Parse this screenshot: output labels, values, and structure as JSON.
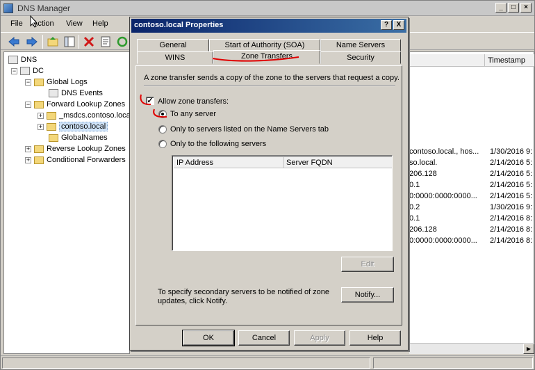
{
  "main": {
    "title": "DNS Manager",
    "menu": [
      "File",
      "Action",
      "View",
      "Help"
    ]
  },
  "tree": {
    "root": "DNS",
    "server": "DC",
    "global_logs": "Global Logs",
    "dns_events": "DNS Events",
    "forward_zones": "Forward Lookup Zones",
    "msdcs": "_msdcs.contoso.local",
    "contoso": "contoso.local",
    "globalnames": "GlobalNames",
    "reverse_zones": "Reverse Lookup Zones",
    "conditional": "Conditional Forwarders"
  },
  "list": {
    "timestamp_header": "Timestamp",
    "rows": [
      {
        "data": "contoso.local., hos...",
        "ts": "1/30/2016 9:"
      },
      {
        "data": "so.local.",
        "ts": "2/14/2016 5:"
      },
      {
        "data": "206.128",
        "ts": "2/14/2016 5:"
      },
      {
        "data": "0.1",
        "ts": "2/14/2016 5:"
      },
      {
        "data": "0:0000:0000:0000...",
        "ts": "2/14/2016 5:"
      },
      {
        "data": "0.2",
        "ts": "1/30/2016 9:"
      },
      {
        "data": "0.1",
        "ts": "2/14/2016 8:"
      },
      {
        "data": "206.128",
        "ts": "2/14/2016 8:"
      },
      {
        "data": "0:0000:0000:0000...",
        "ts": "2/14/2016 8:"
      }
    ]
  },
  "dialog": {
    "title": "contoso.local Properties",
    "help_glyph": "?",
    "close_glyph": "X",
    "tabs": {
      "general": "General",
      "soa": "Start of Authority (SOA)",
      "name_servers": "Name Servers",
      "wins": "WINS",
      "zone_transfers": "Zone Transfers",
      "security": "Security"
    },
    "description": "A zone transfer sends a copy of the zone to the servers that request a copy.",
    "allow_label": "Allow zone transfers:",
    "allow_checked": true,
    "options": {
      "any": "To any server",
      "name_servers": "Only to servers listed on the Name Servers tab",
      "following": "Only to the following servers"
    },
    "selected_option": "any",
    "table_headers": [
      "IP Address",
      "Server FQDN"
    ],
    "edit_label": "Edit",
    "note": "To specify secondary servers to be notified of zone updates, click Notify.",
    "notify_label": "Notify...",
    "ok_label": "OK",
    "cancel_label": "Cancel",
    "apply_label": "Apply",
    "help_label": "Help"
  },
  "colors": {
    "annotation": "#e00000",
    "dialog_title": "#0a246a"
  }
}
